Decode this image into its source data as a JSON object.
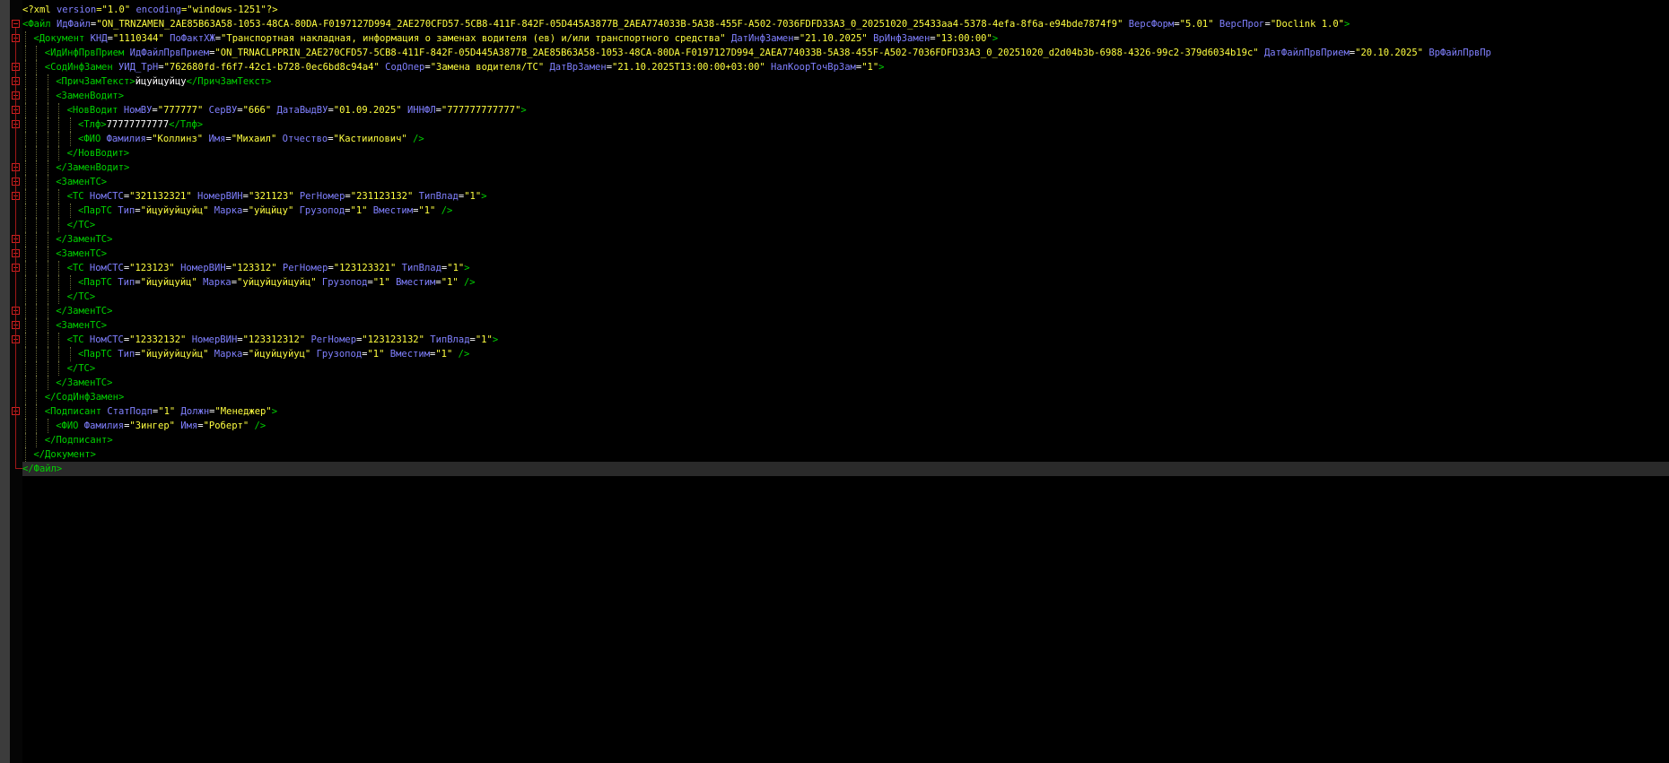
{
  "editor": {
    "language": "xml",
    "current_line_index": 32,
    "colors": {
      "background": "#000000",
      "tag": "#00d200",
      "attribute": "#8080ff",
      "value": "#ffff40",
      "text": "#ffffff",
      "current_line": "#2a2a2a",
      "fold_marker": "#d02020"
    },
    "fold_icon": "fold-collapse-icon",
    "fold_lines": [
      1,
      2,
      4,
      5,
      6,
      7,
      8,
      11,
      12,
      13,
      16,
      17,
      18,
      21,
      22,
      23,
      28
    ]
  },
  "lines": [
    {
      "indent": 0,
      "tokens": [
        [
          "pi",
          "<?xml "
        ],
        [
          "a",
          "version"
        ],
        [
          "pi",
          "="
        ],
        [
          "v",
          "\"1.0\""
        ],
        [
          "pi",
          " "
        ],
        [
          "a",
          "encoding"
        ],
        [
          "pi",
          "="
        ],
        [
          "v",
          "\"windows-1251\""
        ],
        [
          "pi",
          "?>"
        ]
      ]
    },
    {
      "indent": 0,
      "tokens": [
        [
          "t",
          "<Файл "
        ],
        [
          "a",
          "ИдФайл"
        ],
        [
          "x",
          "="
        ],
        [
          "v",
          "\"ON_TRNZAMEN_2AE85B63A58-1053-48CA-80DA-F0197127D994_2AE270CFD57-5CB8-411F-842F-05D445A3877B_2AEA774033B-5A38-455F-A502-7036FDFD33A3_0_20251020_25433aa4-5378-4efa-8f6a-e94bde7874f9\""
        ],
        [
          "x",
          " "
        ],
        [
          "a",
          "ВерсФорм"
        ],
        [
          "x",
          "="
        ],
        [
          "v",
          "\"5.01\""
        ],
        [
          "x",
          " "
        ],
        [
          "a",
          "ВерсПрог"
        ],
        [
          "x",
          "="
        ],
        [
          "v",
          "\"Doclink 1.0\""
        ],
        [
          "t",
          ">"
        ]
      ]
    },
    {
      "indent": 1,
      "tokens": [
        [
          "t",
          "<Документ "
        ],
        [
          "a",
          "КНД"
        ],
        [
          "x",
          "="
        ],
        [
          "v",
          "\"1110344\""
        ],
        [
          "x",
          " "
        ],
        [
          "a",
          "ПоФактХЖ"
        ],
        [
          "x",
          "="
        ],
        [
          "v",
          "\"Транспортная накладная, информация о заменах водителя (ев) и/или транспортного средства\""
        ],
        [
          "x",
          " "
        ],
        [
          "a",
          "ДатИнфЗамен"
        ],
        [
          "x",
          "="
        ],
        [
          "v",
          "\"21.10.2025\""
        ],
        [
          "x",
          " "
        ],
        [
          "a",
          "ВрИнфЗамен"
        ],
        [
          "x",
          "="
        ],
        [
          "v",
          "\"13:00:00\""
        ],
        [
          "t",
          ">"
        ]
      ]
    },
    {
      "indent": 2,
      "tokens": [
        [
          "t",
          "<ИдИнфПрвПрием "
        ],
        [
          "a",
          "ИдФайлПрвПрием"
        ],
        [
          "x",
          "="
        ],
        [
          "v",
          "\"ON_TRNACLPPRIN_2AE270CFD57-5CB8-411F-842F-05D445A3877B_2AE85B63A58-1053-48CA-80DA-F0197127D994_2AEA774033B-5A38-455F-A502-7036FDFD33A3_0_20251020_d2d04b3b-6988-4326-99c2-379d6034b19c\""
        ],
        [
          "x",
          " "
        ],
        [
          "a",
          "ДатФайлПрвПрием"
        ],
        [
          "x",
          "="
        ],
        [
          "v",
          "\"20.10.2025\""
        ],
        [
          "x",
          " "
        ],
        [
          "a",
          "ВрФайлПрвПр"
        ]
      ]
    },
    {
      "indent": 2,
      "tokens": [
        [
          "t",
          "<СодИнфЗамен "
        ],
        [
          "a",
          "УИД_ТрН"
        ],
        [
          "x",
          "="
        ],
        [
          "v",
          "\"762680fd-f6f7-42c1-b728-0ec6bd8c94a4\""
        ],
        [
          "x",
          " "
        ],
        [
          "a",
          "СодОпер"
        ],
        [
          "x",
          "="
        ],
        [
          "v",
          "\"Замена водителя/ТС\""
        ],
        [
          "x",
          " "
        ],
        [
          "a",
          "ДатВрЗамен"
        ],
        [
          "x",
          "="
        ],
        [
          "v",
          "\"21.10.2025T13:00:00+03:00\""
        ],
        [
          "x",
          " "
        ],
        [
          "a",
          "НалКоорТочВрЗам"
        ],
        [
          "x",
          "="
        ],
        [
          "v",
          "\"1\""
        ],
        [
          "t",
          ">"
        ]
      ]
    },
    {
      "indent": 3,
      "tokens": [
        [
          "t",
          "<ПричЗамТекст>"
        ],
        [
          "x",
          "йцуйцуйцу"
        ],
        [
          "t",
          "</ПричЗамТекст>"
        ]
      ]
    },
    {
      "indent": 3,
      "tokens": [
        [
          "t",
          "<ЗаменВодит>"
        ]
      ]
    },
    {
      "indent": 4,
      "tokens": [
        [
          "t",
          "<НовВодит "
        ],
        [
          "a",
          "НомВУ"
        ],
        [
          "x",
          "="
        ],
        [
          "v",
          "\"777777\""
        ],
        [
          "x",
          " "
        ],
        [
          "a",
          "СерВУ"
        ],
        [
          "x",
          "="
        ],
        [
          "v",
          "\"666\""
        ],
        [
          "x",
          " "
        ],
        [
          "a",
          "ДатаВыдВУ"
        ],
        [
          "x",
          "="
        ],
        [
          "v",
          "\"01.09.2025\""
        ],
        [
          "x",
          " "
        ],
        [
          "a",
          "ИННФЛ"
        ],
        [
          "x",
          "="
        ],
        [
          "v",
          "\"777777777777\""
        ],
        [
          "t",
          ">"
        ]
      ]
    },
    {
      "indent": 5,
      "tokens": [
        [
          "t",
          "<Тлф>"
        ],
        [
          "x",
          "77777777777"
        ],
        [
          "t",
          "</Тлф>"
        ]
      ]
    },
    {
      "indent": 5,
      "tokens": [
        [
          "t",
          "<ФИО "
        ],
        [
          "a",
          "Фамилия"
        ],
        [
          "x",
          "="
        ],
        [
          "v",
          "\"Коллинз\""
        ],
        [
          "x",
          " "
        ],
        [
          "a",
          "Имя"
        ],
        [
          "x",
          "="
        ],
        [
          "v",
          "\"Михаил\""
        ],
        [
          "x",
          " "
        ],
        [
          "a",
          "Отчество"
        ],
        [
          "x",
          "="
        ],
        [
          "v",
          "\"Кастиилович\""
        ],
        [
          "x",
          " "
        ],
        [
          "t",
          "/>"
        ]
      ]
    },
    {
      "indent": 4,
      "tokens": [
        [
          "t",
          "</НовВодит>"
        ]
      ]
    },
    {
      "indent": 3,
      "tokens": [
        [
          "t",
          "</ЗаменВодит>"
        ]
      ]
    },
    {
      "indent": 3,
      "tokens": [
        [
          "t",
          "<ЗаменТС>"
        ]
      ]
    },
    {
      "indent": 4,
      "tokens": [
        [
          "t",
          "<ТС "
        ],
        [
          "a",
          "НомСТС"
        ],
        [
          "x",
          "="
        ],
        [
          "v",
          "\"321132321\""
        ],
        [
          "x",
          " "
        ],
        [
          "a",
          "НомерВИН"
        ],
        [
          "x",
          "="
        ],
        [
          "v",
          "\"321123\""
        ],
        [
          "x",
          " "
        ],
        [
          "a",
          "РегНомер"
        ],
        [
          "x",
          "="
        ],
        [
          "v",
          "\"231123132\""
        ],
        [
          "x",
          " "
        ],
        [
          "a",
          "ТипВлад"
        ],
        [
          "x",
          "="
        ],
        [
          "v",
          "\"1\""
        ],
        [
          "t",
          ">"
        ]
      ]
    },
    {
      "indent": 5,
      "tokens": [
        [
          "t",
          "<ПарТС "
        ],
        [
          "a",
          "Тип"
        ],
        [
          "x",
          "="
        ],
        [
          "v",
          "\"йцуйуйцуйц\""
        ],
        [
          "x",
          " "
        ],
        [
          "a",
          "Марка"
        ],
        [
          "x",
          "="
        ],
        [
          "v",
          "\"уйцйцу\""
        ],
        [
          "x",
          " "
        ],
        [
          "a",
          "Грузопод"
        ],
        [
          "x",
          "="
        ],
        [
          "v",
          "\"1\""
        ],
        [
          "x",
          " "
        ],
        [
          "a",
          "Вместим"
        ],
        [
          "x",
          "="
        ],
        [
          "v",
          "\"1\""
        ],
        [
          "x",
          " "
        ],
        [
          "t",
          "/>"
        ]
      ]
    },
    {
      "indent": 4,
      "tokens": [
        [
          "t",
          "</ТС>"
        ]
      ]
    },
    {
      "indent": 3,
      "tokens": [
        [
          "t",
          "</ЗаменТС>"
        ]
      ]
    },
    {
      "indent": 3,
      "tokens": [
        [
          "t",
          "<ЗаменТС>"
        ]
      ]
    },
    {
      "indent": 4,
      "tokens": [
        [
          "t",
          "<ТС "
        ],
        [
          "a",
          "НомСТС"
        ],
        [
          "x",
          "="
        ],
        [
          "v",
          "\"123123\""
        ],
        [
          "x",
          " "
        ],
        [
          "a",
          "НомерВИН"
        ],
        [
          "x",
          "="
        ],
        [
          "v",
          "\"123312\""
        ],
        [
          "x",
          " "
        ],
        [
          "a",
          "РегНомер"
        ],
        [
          "x",
          "="
        ],
        [
          "v",
          "\"123123321\""
        ],
        [
          "x",
          " "
        ],
        [
          "a",
          "ТипВлад"
        ],
        [
          "x",
          "="
        ],
        [
          "v",
          "\"1\""
        ],
        [
          "t",
          ">"
        ]
      ]
    },
    {
      "indent": 5,
      "tokens": [
        [
          "t",
          "<ПарТС "
        ],
        [
          "a",
          "Тип"
        ],
        [
          "x",
          "="
        ],
        [
          "v",
          "\"йцуйцуйц\""
        ],
        [
          "x",
          " "
        ],
        [
          "a",
          "Марка"
        ],
        [
          "x",
          "="
        ],
        [
          "v",
          "\"уйцуйцуйцуйц\""
        ],
        [
          "x",
          " "
        ],
        [
          "a",
          "Грузопод"
        ],
        [
          "x",
          "="
        ],
        [
          "v",
          "\"1\""
        ],
        [
          "x",
          " "
        ],
        [
          "a",
          "Вместим"
        ],
        [
          "x",
          "="
        ],
        [
          "v",
          "\"1\""
        ],
        [
          "x",
          " "
        ],
        [
          "t",
          "/>"
        ]
      ]
    },
    {
      "indent": 4,
      "tokens": [
        [
          "t",
          "</ТС>"
        ]
      ]
    },
    {
      "indent": 3,
      "tokens": [
        [
          "t",
          "</ЗаменТС>"
        ]
      ]
    },
    {
      "indent": 3,
      "tokens": [
        [
          "t",
          "<ЗаменТС>"
        ]
      ]
    },
    {
      "indent": 4,
      "tokens": [
        [
          "t",
          "<ТС "
        ],
        [
          "a",
          "НомСТС"
        ],
        [
          "x",
          "="
        ],
        [
          "v",
          "\"12332132\""
        ],
        [
          "x",
          " "
        ],
        [
          "a",
          "НомерВИН"
        ],
        [
          "x",
          "="
        ],
        [
          "v",
          "\"123312312\""
        ],
        [
          "x",
          " "
        ],
        [
          "a",
          "РегНомер"
        ],
        [
          "x",
          "="
        ],
        [
          "v",
          "\"123123132\""
        ],
        [
          "x",
          " "
        ],
        [
          "a",
          "ТипВлад"
        ],
        [
          "x",
          "="
        ],
        [
          "v",
          "\"1\""
        ],
        [
          "t",
          ">"
        ]
      ]
    },
    {
      "indent": 5,
      "tokens": [
        [
          "t",
          "<ПарТС "
        ],
        [
          "a",
          "Тип"
        ],
        [
          "x",
          "="
        ],
        [
          "v",
          "\"йцуйуйцуйц\""
        ],
        [
          "x",
          " "
        ],
        [
          "a",
          "Марка"
        ],
        [
          "x",
          "="
        ],
        [
          "v",
          "\"йцуйцуйуц\""
        ],
        [
          "x",
          " "
        ],
        [
          "a",
          "Грузопод"
        ],
        [
          "x",
          "="
        ],
        [
          "v",
          "\"1\""
        ],
        [
          "x",
          " "
        ],
        [
          "a",
          "Вместим"
        ],
        [
          "x",
          "="
        ],
        [
          "v",
          "\"1\""
        ],
        [
          "x",
          " "
        ],
        [
          "t",
          "/>"
        ]
      ]
    },
    {
      "indent": 4,
      "tokens": [
        [
          "t",
          "</ТС>"
        ]
      ]
    },
    {
      "indent": 3,
      "tokens": [
        [
          "t",
          "</ЗаменТС>"
        ]
      ]
    },
    {
      "indent": 2,
      "tokens": [
        [
          "t",
          "</СодИнфЗамен>"
        ]
      ]
    },
    {
      "indent": 2,
      "tokens": [
        [
          "t",
          "<Подписант "
        ],
        [
          "a",
          "СтатПодп"
        ],
        [
          "x",
          "="
        ],
        [
          "v",
          "\"1\""
        ],
        [
          "x",
          " "
        ],
        [
          "a",
          "Должн"
        ],
        [
          "x",
          "="
        ],
        [
          "v",
          "\"Менеджер\""
        ],
        [
          "t",
          ">"
        ]
      ]
    },
    {
      "indent": 3,
      "tokens": [
        [
          "t",
          "<ФИО "
        ],
        [
          "a",
          "Фамилия"
        ],
        [
          "x",
          "="
        ],
        [
          "v",
          "\"Зингер\""
        ],
        [
          "x",
          " "
        ],
        [
          "a",
          "Имя"
        ],
        [
          "x",
          "="
        ],
        [
          "v",
          "\"Роберт\""
        ],
        [
          "x",
          " "
        ],
        [
          "t",
          "/>"
        ]
      ]
    },
    {
      "indent": 2,
      "tokens": [
        [
          "t",
          "</Подписант>"
        ]
      ]
    },
    {
      "indent": 1,
      "tokens": [
        [
          "t",
          "</Документ>"
        ]
      ]
    },
    {
      "indent": 0,
      "tokens": [
        [
          "t",
          "</Файл>"
        ]
      ]
    }
  ]
}
